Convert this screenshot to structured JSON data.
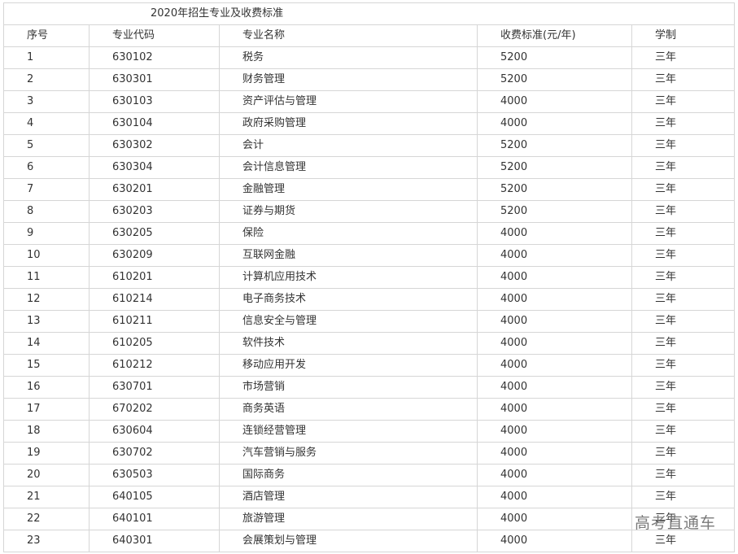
{
  "table": {
    "title": "2020年招生专业及收费标准",
    "headers": [
      "序号",
      "专业代码",
      "专业名称",
      "收费标准(元/年)",
      "学制"
    ],
    "rows": [
      [
        "1",
        "630102",
        "税务",
        "5200",
        "三年"
      ],
      [
        "2",
        "630301",
        "财务管理",
        "5200",
        "三年"
      ],
      [
        "3",
        "630103",
        "资产评估与管理",
        "4000",
        "三年"
      ],
      [
        "4",
        "630104",
        "政府采购管理",
        "4000",
        "三年"
      ],
      [
        "5",
        "630302",
        "会计",
        "5200",
        "三年"
      ],
      [
        "6",
        "630304",
        "会计信息管理",
        "5200",
        "三年"
      ],
      [
        "7",
        "630201",
        "金融管理",
        "5200",
        "三年"
      ],
      [
        "8",
        "630203",
        "证券与期货",
        "5200",
        "三年"
      ],
      [
        "9",
        "630205",
        "保险",
        "4000",
        "三年"
      ],
      [
        "10",
        "630209",
        "互联网金融",
        "4000",
        "三年"
      ],
      [
        "11",
        "610201",
        "计算机应用技术",
        "4000",
        "三年"
      ],
      [
        "12",
        "610214",
        "电子商务技术",
        "4000",
        "三年"
      ],
      [
        "13",
        "610211",
        "信息安全与管理",
        "4000",
        "三年"
      ],
      [
        "14",
        "610205",
        "软件技术",
        "4000",
        "三年"
      ],
      [
        "15",
        "610212",
        "移动应用开发",
        "4000",
        "三年"
      ],
      [
        "16",
        "630701",
        "市场营销",
        "4000",
        "三年"
      ],
      [
        "17",
        "670202",
        "商务英语",
        "4000",
        "三年"
      ],
      [
        "18",
        "630604",
        "连锁经营管理",
        "4000",
        "三年"
      ],
      [
        "19",
        "630702",
        "汽车营销与服务",
        "4000",
        "三年"
      ],
      [
        "20",
        "630503",
        "国际商务",
        "4000",
        "三年"
      ],
      [
        "21",
        "640105",
        "酒店管理",
        "4000",
        "三年"
      ],
      [
        "22",
        "640101",
        "旅游管理",
        "4000",
        "三年"
      ],
      [
        "23",
        "640301",
        "会展策划与管理",
        "4000",
        "三年"
      ]
    ]
  },
  "watermark": "高考直通车",
  "colors": {
    "border": "#d6d6d6",
    "text": "#333333",
    "watermark": "#7a7a7a"
  }
}
